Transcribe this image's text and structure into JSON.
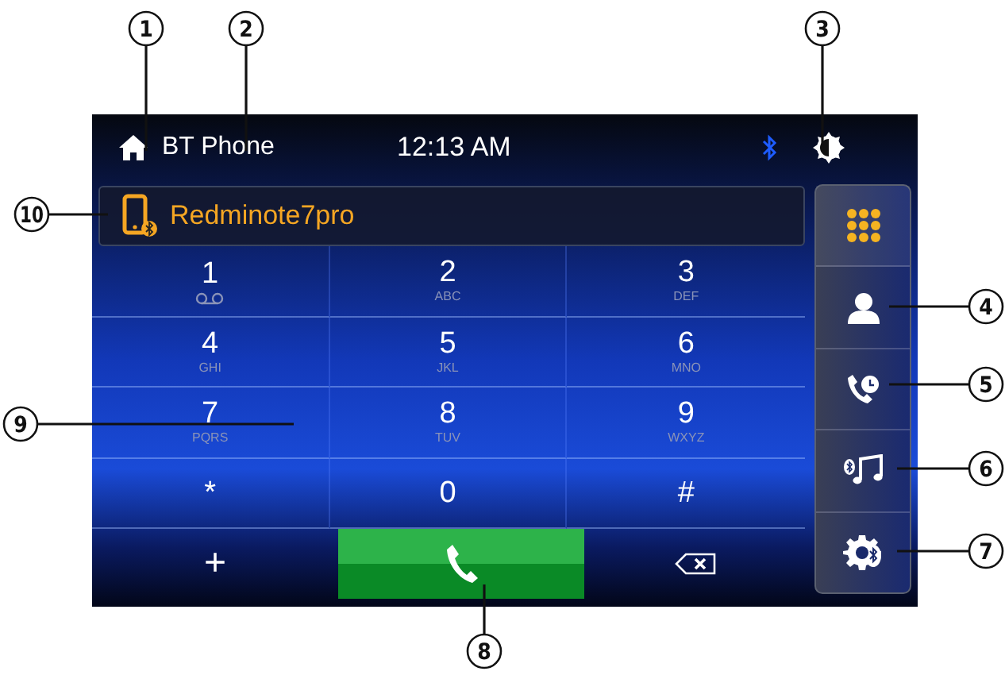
{
  "status_bar": {
    "title": "BT Phone",
    "time": "12:13 AM"
  },
  "device": {
    "name": "Redminote7pro"
  },
  "keypad": [
    {
      "kind": "voicemail",
      "digit": "1"
    },
    {
      "kind": "letters",
      "digit": "2",
      "letters": "ABC"
    },
    {
      "kind": "letters",
      "digit": "3",
      "letters": "DEF"
    },
    {
      "kind": "letters",
      "digit": "4",
      "letters": "GHI"
    },
    {
      "kind": "letters",
      "digit": "5",
      "letters": "JKL"
    },
    {
      "kind": "letters",
      "digit": "6",
      "letters": "MNO"
    },
    {
      "kind": "letters",
      "digit": "7",
      "letters": "PQRS"
    },
    {
      "kind": "letters",
      "digit": "8",
      "letters": "TUV"
    },
    {
      "kind": "letters",
      "digit": "9",
      "letters": "WXYZ"
    },
    {
      "kind": "symbol",
      "digit": "*"
    },
    {
      "kind": "symbol",
      "digit": "0"
    },
    {
      "kind": "symbol",
      "digit": "#"
    }
  ],
  "actions": [
    {
      "kind": "plus",
      "label": "+"
    },
    {
      "kind": "call"
    },
    {
      "kind": "backspace"
    }
  ],
  "sidebar": {
    "items": [
      {
        "kind": "keypad",
        "selected": true
      },
      {
        "kind": "contacts",
        "selected": false
      },
      {
        "kind": "recents",
        "selected": false
      },
      {
        "kind": "music",
        "selected": false
      },
      {
        "kind": "settings",
        "selected": false
      }
    ]
  },
  "callouts": [
    "1",
    "2",
    "3",
    "4",
    "5",
    "6",
    "7",
    "8",
    "9",
    "10"
  ]
}
